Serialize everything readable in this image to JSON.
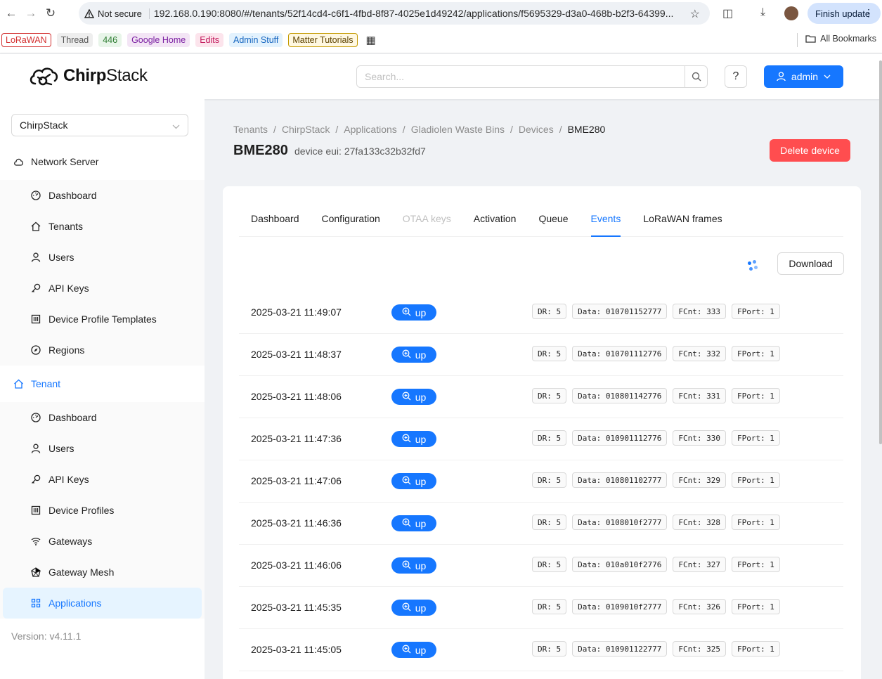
{
  "browser": {
    "security_label": "Not secure",
    "url": "192.168.0.190:8080/#/tenants/52f14cd4-c6f1-4fbd-8f87-4025e1d49242/applications/f5695329-d3a0-468b-b2f3-64399...",
    "finish_update": "Finish update",
    "bookmarks": [
      {
        "label": "LoRaWAN",
        "color": "#d32f2f",
        "bg": "#fff",
        "border": "#d32f2f"
      },
      {
        "label": "Thread",
        "color": "#555",
        "bg": "#eee",
        "border": "#eee"
      },
      {
        "label": "446",
        "color": "#2e7d32",
        "bg": "#e8f5e9",
        "border": "#e8f5e9"
      },
      {
        "label": "Google Home",
        "color": "#7b1fa2",
        "bg": "#f3e5f5",
        "border": "#f3e5f5"
      },
      {
        "label": "Edits",
        "color": "#c2185b",
        "bg": "#fce4ec",
        "border": "#fce4ec"
      },
      {
        "label": "Admin Stuff",
        "color": "#1565c0",
        "bg": "#e3f2fd",
        "border": "#e3f2fd"
      },
      {
        "label": "Matter Tutorials",
        "color": "#5d4200",
        "bg": "#fff8e1",
        "border": "#c49a00"
      }
    ],
    "all_bookmarks": "All Bookmarks"
  },
  "header": {
    "logo_prefix": "Chirp",
    "logo_suffix": "Stack",
    "search_placeholder": "Search...",
    "help": "?",
    "user": "admin"
  },
  "sidebar": {
    "tenant": "ChirpStack",
    "network_server": "Network Server",
    "ns_items": [
      "Dashboard",
      "Tenants",
      "Users",
      "API Keys",
      "Device Profile Templates",
      "Regions"
    ],
    "tenant_group": "Tenant",
    "tenant_items": [
      "Dashboard",
      "Users",
      "API Keys",
      "Device Profiles",
      "Gateways",
      "Gateway Mesh",
      "Applications"
    ],
    "version": "Version: v4.11.1"
  },
  "breadcrumb": [
    "Tenants",
    "ChirpStack",
    "Applications",
    "Gladiolen Waste Bins",
    "Devices",
    "BME280"
  ],
  "device": {
    "title": "BME280",
    "subtitle": "device eui: 27fa133c32b32fd7",
    "delete_label": "Delete device"
  },
  "tabs": [
    "Dashboard",
    "Configuration",
    "OTAA keys",
    "Activation",
    "Queue",
    "Events",
    "LoRaWAN frames"
  ],
  "download_label": "Download",
  "events": [
    {
      "time": "2025-03-21 11:49:07",
      "type": "up",
      "dr": "DR: 5",
      "data": "Data: 010701152777",
      "fcnt": "FCnt: 333",
      "fport": "FPort: 1"
    },
    {
      "time": "2025-03-21 11:48:37",
      "type": "up",
      "dr": "DR: 5",
      "data": "Data: 010701112776",
      "fcnt": "FCnt: 332",
      "fport": "FPort: 1"
    },
    {
      "time": "2025-03-21 11:48:06",
      "type": "up",
      "dr": "DR: 5",
      "data": "Data: 010801142776",
      "fcnt": "FCnt: 331",
      "fport": "FPort: 1"
    },
    {
      "time": "2025-03-21 11:47:36",
      "type": "up",
      "dr": "DR: 5",
      "data": "Data: 010901112776",
      "fcnt": "FCnt: 330",
      "fport": "FPort: 1"
    },
    {
      "time": "2025-03-21 11:47:06",
      "type": "up",
      "dr": "DR: 5",
      "data": "Data: 010801102777",
      "fcnt": "FCnt: 329",
      "fport": "FPort: 1"
    },
    {
      "time": "2025-03-21 11:46:36",
      "type": "up",
      "dr": "DR: 5",
      "data": "Data: 0108010f2777",
      "fcnt": "FCnt: 328",
      "fport": "FPort: 1"
    },
    {
      "time": "2025-03-21 11:46:06",
      "type": "up",
      "dr": "DR: 5",
      "data": "Data: 010a010f2776",
      "fcnt": "FCnt: 327",
      "fport": "FPort: 1"
    },
    {
      "time": "2025-03-21 11:45:35",
      "type": "up",
      "dr": "DR: 5",
      "data": "Data: 0109010f2777",
      "fcnt": "FCnt: 326",
      "fport": "FPort: 1"
    },
    {
      "time": "2025-03-21 11:45:05",
      "type": "up",
      "dr": "DR: 5",
      "data": "Data: 010901122777",
      "fcnt": "FCnt: 325",
      "fport": "FPort: 1"
    }
  ],
  "colors": {
    "primary": "#1677ff",
    "danger": "#ff4d4f"
  }
}
